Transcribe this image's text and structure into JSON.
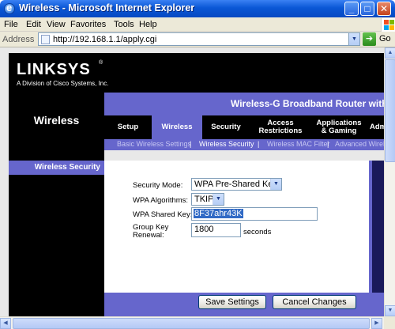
{
  "window": {
    "title": "Wireless - Microsoft Internet Explorer",
    "controls": {
      "minimize": "_",
      "maximize": "□",
      "close": "✕"
    }
  },
  "menu": [
    "File",
    "Edit",
    "View",
    "Favorites",
    "Tools",
    "Help"
  ],
  "address_bar": {
    "label": "Address",
    "url": "http://192.168.1.1/apply.cgi",
    "go_label": "Go"
  },
  "page": {
    "logo": "LINKSYS",
    "logo_mark": "®",
    "logo_sub": "A Division of Cisco Systems, Inc.",
    "product_name": "Wireless-G Broadband Router with SpeedBooster",
    "section_title": "Wireless",
    "tabs": [
      {
        "label": "Setup",
        "active": false
      },
      {
        "label": "Wireless",
        "active": true
      },
      {
        "label": "Security",
        "active": false
      },
      {
        "label": "Access Restrictions",
        "active": false
      },
      {
        "label": "Applications & Gaming",
        "active": false
      },
      {
        "label": "Administration",
        "active": false
      }
    ],
    "subnav": [
      {
        "label": "Basic Wireless Settings",
        "active": false
      },
      {
        "label": "Wireless Security",
        "active": true
      },
      {
        "label": "Wireless MAC Filter",
        "active": false
      },
      {
        "label": "Advanced Wireless Settings",
        "active": false
      }
    ],
    "subnav_separator": "|",
    "section_label": "Wireless Security",
    "form": {
      "security_mode_label": "Security Mode:",
      "security_mode_value": "WPA Pre-Shared Key",
      "wpa_algorithms_label": "WPA Algorithms:",
      "wpa_algorithms_value": "TKIP",
      "wpa_shared_key_label": "WPA Shared  Key:",
      "wpa_shared_key_value": "8F37ahr43K",
      "group_key_label_1": "Group Key",
      "group_key_label_2": "Renewal:",
      "group_key_value": "1800",
      "group_key_unit": "seconds"
    },
    "buttons": {
      "save": "Save Settings",
      "cancel": "Cancel Changes"
    }
  },
  "colors": {
    "brand_purple": "#6666cc",
    "header_black": "#000000",
    "xp_blue": "#0a57d6"
  }
}
